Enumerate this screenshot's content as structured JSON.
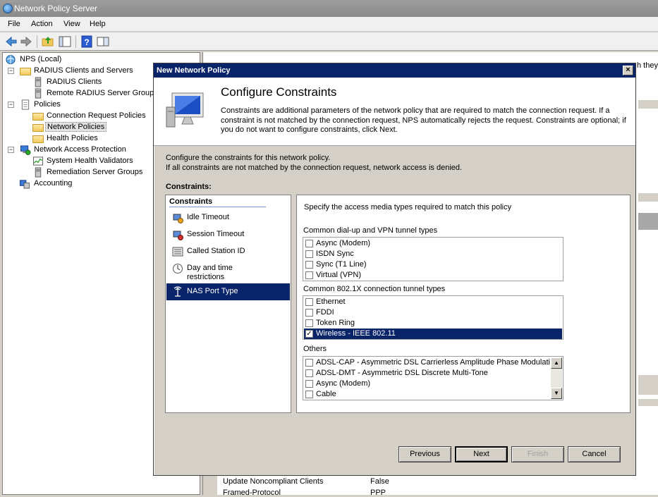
{
  "app": {
    "title": "Network Policy Server"
  },
  "menu": [
    "File",
    "Action",
    "View",
    "Help"
  ],
  "tree": {
    "root": "NPS (Local)",
    "radius": "RADIUS Clients and Servers",
    "radius_clients": "RADIUS Clients",
    "remote_groups": "Remote RADIUS Server Groups",
    "policies": "Policies",
    "conn_request": "Connection Request Policies",
    "network_policies": "Network Policies",
    "health_policies": "Health Policies",
    "nap": "Network Access Protection",
    "shv": "System Health Validators",
    "remediation": "Remediation Server Groups",
    "accounting": "Accounting"
  },
  "right_pane": {
    "partial_text": "h they",
    "rows": [
      {
        "name": "Update Noncompliant Clients",
        "value": "False"
      },
      {
        "name": "Framed-Protocol",
        "value": "PPP"
      }
    ]
  },
  "dialog": {
    "title": "New Network Policy",
    "heading": "Configure Constraints",
    "description": "Constraints are additional parameters of the network policy that are required to match the connection request. If a constraint is not matched by the connection request, NPS automatically rejects the request. Constraints are optional; if you do not want to configure constraints, click Next.",
    "intro_line1": "Configure the constraints for this network policy.",
    "intro_line2": "If all constraints are not matched by the connection request, network access is denied.",
    "constraints_label": "Constraints:",
    "list_header": "Constraints",
    "constraints": [
      {
        "label": "Idle Timeout",
        "icon": "idle-timeout-icon"
      },
      {
        "label": "Session Timeout",
        "icon": "session-timeout-icon"
      },
      {
        "label": "Called Station ID",
        "icon": "called-station-icon"
      },
      {
        "label": "Day and time restrictions",
        "icon": "clock-icon"
      },
      {
        "label": "NAS Port Type",
        "icon": "nas-port-icon",
        "selected": true
      }
    ],
    "panel_heading": "Specify the access media types required to match this policy",
    "group1_label": "Common dial-up and VPN tunnel types",
    "group1": [
      {
        "label": "Async (Modem)",
        "checked": false
      },
      {
        "label": "ISDN Sync",
        "checked": false
      },
      {
        "label": "Sync (T1 Line)",
        "checked": false
      },
      {
        "label": "Virtual (VPN)",
        "checked": false
      }
    ],
    "group2_label": "Common 802.1X connection tunnel types",
    "group2": [
      {
        "label": "Ethernet",
        "checked": false
      },
      {
        "label": "FDDI",
        "checked": false
      },
      {
        "label": "Token Ring",
        "checked": false
      },
      {
        "label": "Wireless - IEEE 802.11",
        "checked": true,
        "selected": true
      }
    ],
    "group3_label": "Others",
    "group3": [
      {
        "label": "ADSL-CAP - Asymmetric DSL Carrierless Amplitude Phase Modulation",
        "checked": false
      },
      {
        "label": "ADSL-DMT - Asymmetric DSL Discrete Multi-Tone",
        "checked": false
      },
      {
        "label": "Async (Modem)",
        "checked": false
      },
      {
        "label": "Cable",
        "checked": false
      }
    ],
    "buttons": {
      "previous": "Previous",
      "next": "Next",
      "finish": "Finish",
      "cancel": "Cancel"
    }
  },
  "colors": {
    "selection": "#0a246a",
    "dialog_bg": "#d4d0c8"
  }
}
